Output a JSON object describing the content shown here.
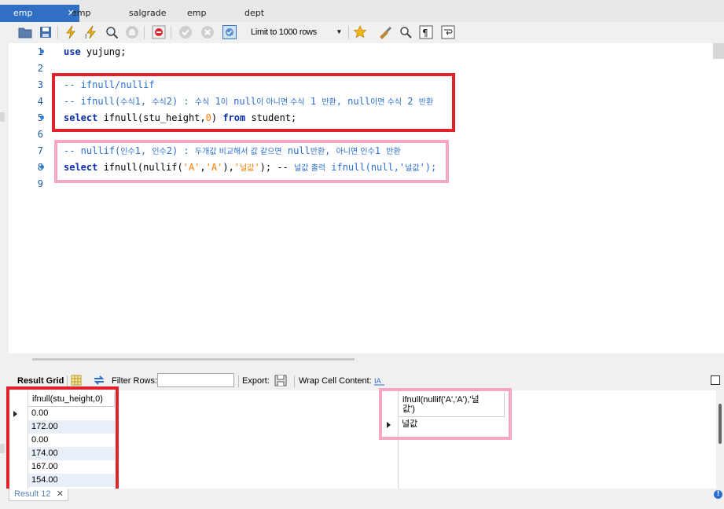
{
  "tabs": [
    {
      "label": "emp",
      "active": true
    },
    {
      "label": "emp"
    },
    {
      "label": "salgrade"
    },
    {
      "label": "emp"
    },
    {
      "label": "dept"
    }
  ],
  "tab_close": "✕",
  "toolbar": {
    "limit_label": "Limit to 1000 rows"
  },
  "editor": {
    "line_numbers": [
      "1",
      "2",
      "3",
      "4",
      "5",
      "6",
      "7",
      "8",
      "9"
    ],
    "line1": {
      "kw": "use",
      "rest": " yujung;"
    },
    "line3": "-- ifnull/nullif",
    "line4": {
      "a": "-- ifnull(",
      "b": "수식",
      "c": "1, ",
      "d": "수식",
      "e": "2) : ",
      "f": "수식",
      "g": " 1",
      "h": "이",
      "i": " null",
      "j": "이 아니면 수식",
      "k": " 1 ",
      "l": "반환",
      "m": ", null",
      "n": "이면 수식",
      "o": " 2 ",
      "p": "반환"
    },
    "line5": {
      "kw1": "select",
      "a": " ifnull(stu_height,",
      "num": "0",
      "b": ") ",
      "kw2": "from",
      "c": " student;"
    },
    "line7": {
      "a": "-- nullif(",
      "b": "인수",
      "c": "1, ",
      "d": "인수",
      "e": "2) : ",
      "f": "두개값 비교해서 값 같으면",
      "g": " null",
      "h": "반환",
      "i": ", ",
      "j": "아니면 인수",
      "k": "1 ",
      "l": "반환"
    },
    "line8": {
      "kw": "select",
      "a": " ifnull(nullif(",
      "s1": "'A'",
      "c1": ",",
      "s2": "'A'",
      "b": "),",
      "s3": "'",
      "s3ko": "널값",
      "s3end": "'",
      "c": "); -- ",
      "d": "널값 출력",
      "e": " ifnull(null,'",
      "f": "널값",
      "g": "');"
    }
  },
  "result_toolbar": {
    "result_grid": "Result Grid",
    "filter_rows": "Filter Rows:",
    "filter_value": "",
    "export": "Export:",
    "wrap": "Wrap Cell Content:"
  },
  "grid1": {
    "header": "ifnull(stu_height,0)",
    "rows": [
      "0.00",
      "172.00",
      "0.00",
      "174.00",
      "167.00",
      "154.00"
    ]
  },
  "grid2": {
    "header_line1": "ifnull(nullif('A','A'),'널",
    "header_line2": "값')",
    "rows": [
      "널값"
    ]
  },
  "result_tab": {
    "label": "Result 12",
    "close": "✕"
  },
  "info": "!"
}
